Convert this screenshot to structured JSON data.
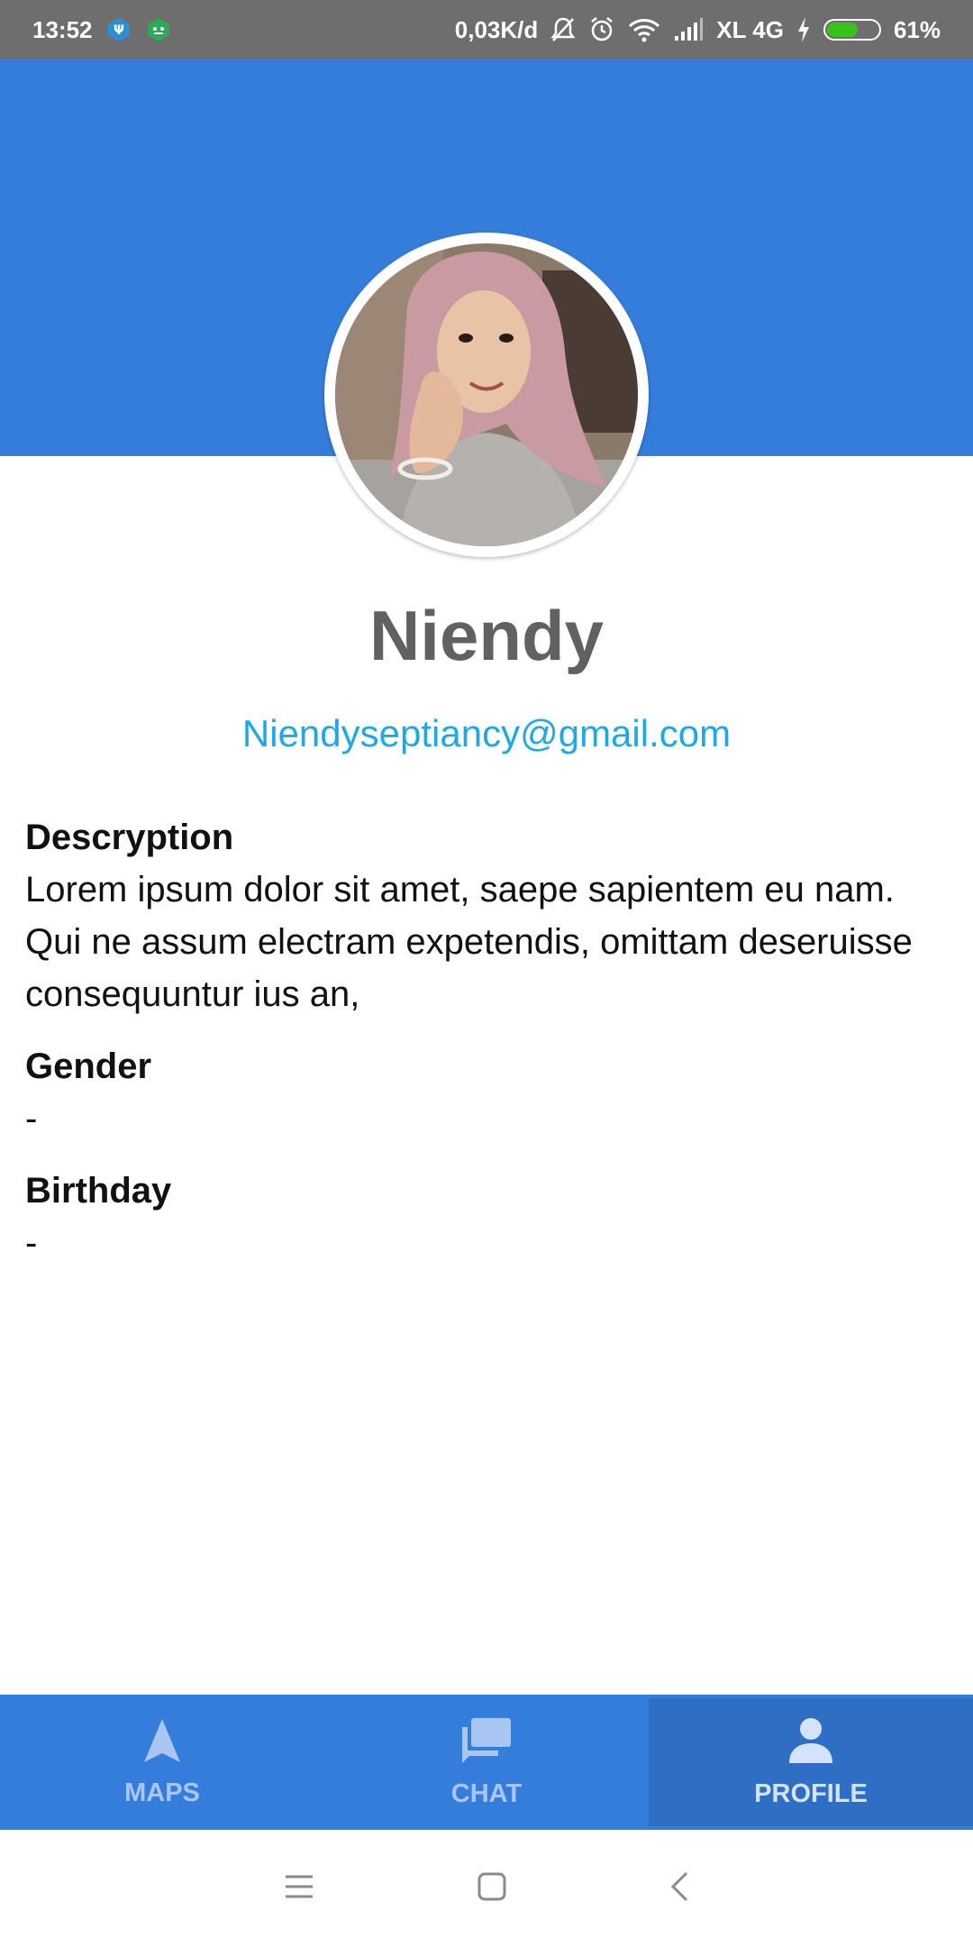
{
  "status_bar": {
    "time": "13:52",
    "speed": "0,03K/d",
    "carrier": "XL 4G",
    "battery_percent": "61%",
    "battery_level": 0.61,
    "battery_color": "#39c21b"
  },
  "profile": {
    "name": "Niendy",
    "email": "Niendyseptiancy@gmail.com"
  },
  "details": {
    "description_label": "Descryption",
    "description_value": "Lorem ipsum dolor sit amet, saepe sapientem eu nam. Qui ne assum electram expetendis, omittam deseruisse consequuntur ius an,",
    "gender_label": "Gender",
    "gender_value": "-",
    "birthday_label": "Birthday",
    "birthday_value": "-"
  },
  "bottom_nav": {
    "items": [
      {
        "label": "MAPS",
        "icon": "navigation-arrow-icon"
      },
      {
        "label": "CHAT",
        "icon": "chat-bubbles-icon"
      },
      {
        "label": "PROFILE",
        "icon": "person-icon"
      }
    ],
    "active": "PROFILE"
  },
  "colors": {
    "header": "#347ddb",
    "email": "#1fa8e8",
    "name": "#616161"
  }
}
